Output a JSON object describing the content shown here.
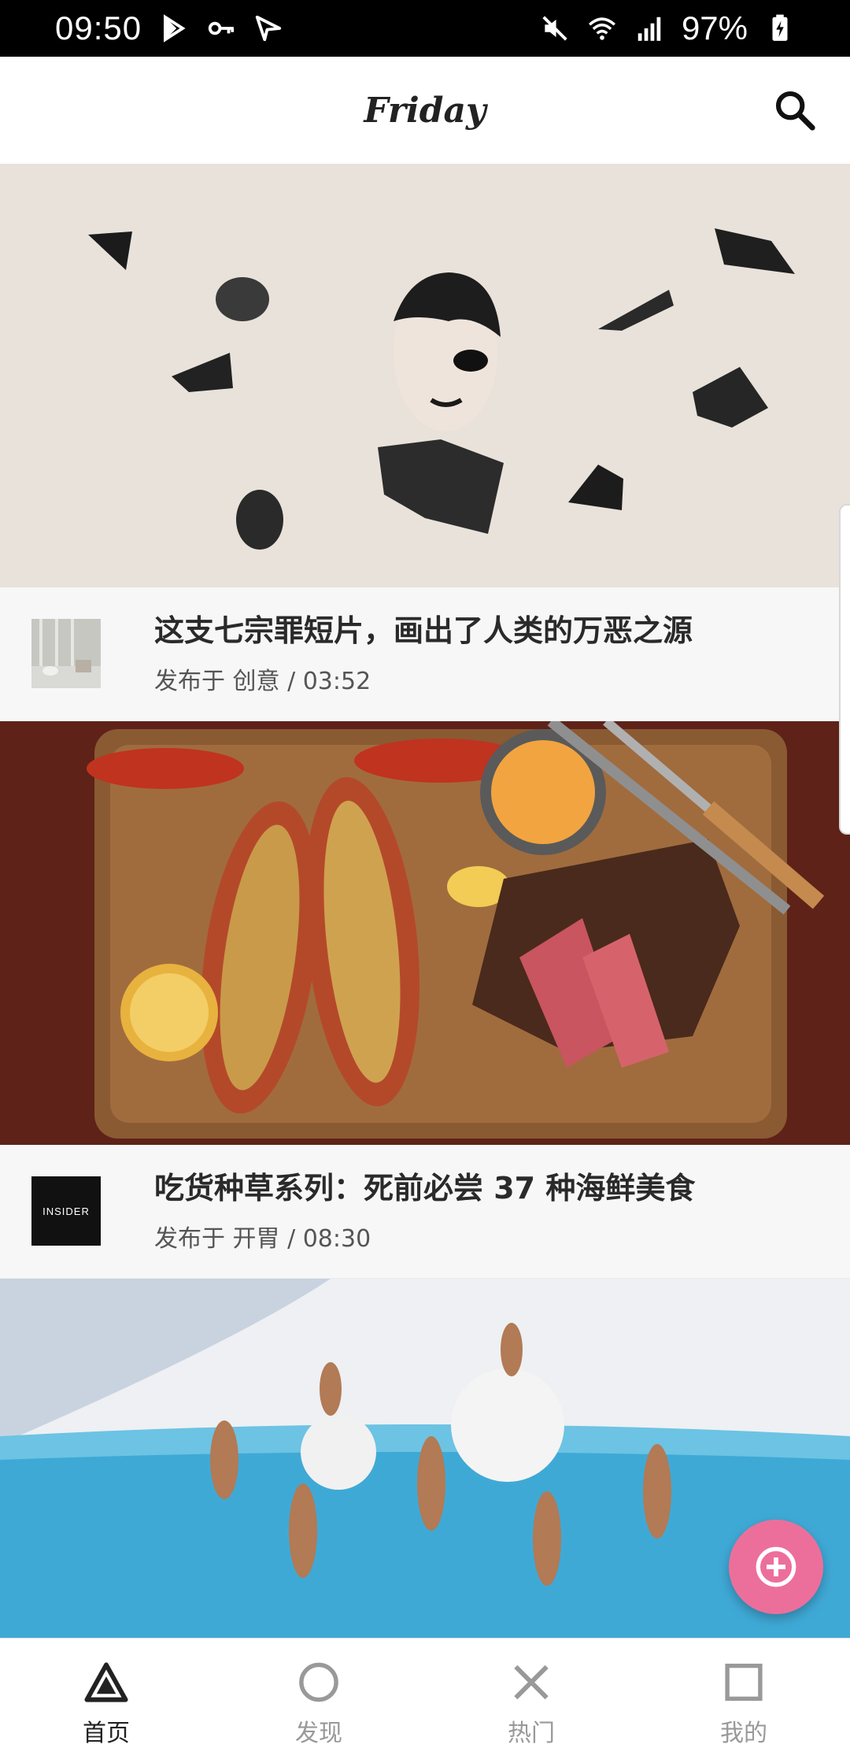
{
  "status_bar": {
    "time": "09:50",
    "battery": "97%",
    "icons": [
      "play-store-icon",
      "key-icon",
      "send-icon",
      "mute-icon",
      "wifi-icon",
      "signal-icon",
      "battery-charging-icon"
    ]
  },
  "header": {
    "title": "Friday",
    "search_icon": "search-icon"
  },
  "feed": {
    "cards": [
      {
        "title": "这支七宗罪短片，画出了人类的万恶之源",
        "subtitle": "发布于 创意 / 03:52",
        "avatar": "thumbnail-room"
      },
      {
        "title": "吃货种草系列：死前必尝 37 种海鲜美食",
        "subtitle": "发布于 开胃 / 08:30",
        "avatar_text": "INSIDER"
      },
      {
        "title": "",
        "subtitle": ""
      }
    ]
  },
  "fab": {
    "icon": "add-circle-icon"
  },
  "bottom_nav": {
    "items": [
      {
        "label": "首页",
        "icon": "triangle-icon",
        "active": true
      },
      {
        "label": "发现",
        "icon": "circle-icon",
        "active": false
      },
      {
        "label": "热门",
        "icon": "cross-icon",
        "active": false
      },
      {
        "label": "我的",
        "icon": "square-icon",
        "active": false
      }
    ]
  },
  "colors": {
    "accent": "#ec6f9b",
    "status_bar": "#000000",
    "meta_background": "#f7f7f7"
  }
}
